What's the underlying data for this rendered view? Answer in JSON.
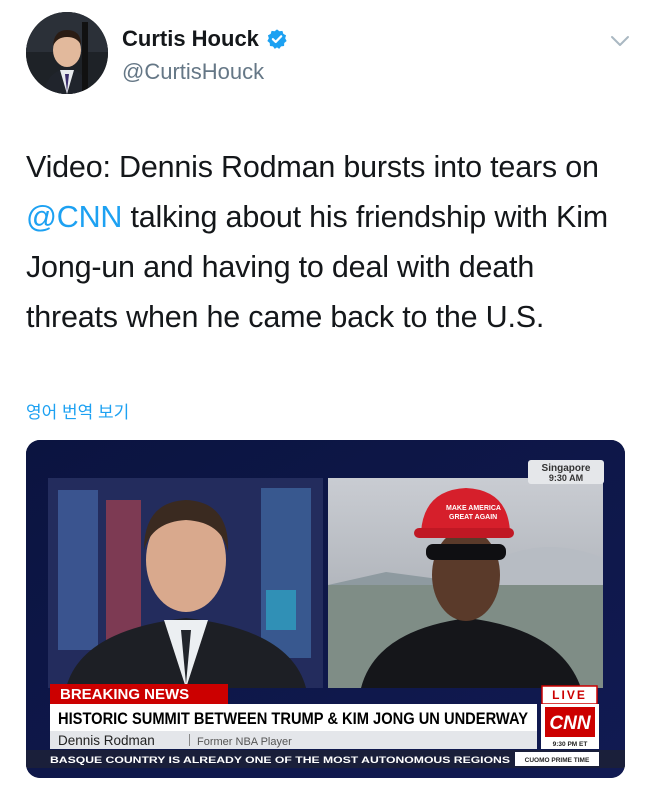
{
  "author": {
    "display_name": "Curtis Houck",
    "handle": "@CurtisHouck",
    "verified": true,
    "avatar_icon": "avatar-photo"
  },
  "tweet": {
    "text_before": "Video: Dennis Rodman bursts into tears on ",
    "mention": "@CNN",
    "text_after": " talking about his friendship with Kim Jong-un and having to deal with death threats when he came back to the U.S."
  },
  "translate_label": "영어 번역 보기",
  "media": {
    "location": "Singapore",
    "time": "9:30 AM",
    "banner_label": "BREAKING NEWS",
    "live_label": "LIVE",
    "headline": "HISTORIC SUMMIT BETWEEN TRUMP & KIM JONG UN UNDERWAY",
    "network": "CNN",
    "guest_name": "Dennis Rodman",
    "guest_title": "Former NBA Player",
    "ticker_text": "BASQUE COUNTRY IS ALREADY ONE OF THE MOST AUTONOMOUS REGIONS",
    "ticker_time": "9:30 PM ET",
    "ticker_show": "CUOMO PRIME TIME"
  },
  "colors": {
    "accent": "#1da1f2",
    "secondary_text": "#657786",
    "cnn_red": "#cc0000"
  }
}
